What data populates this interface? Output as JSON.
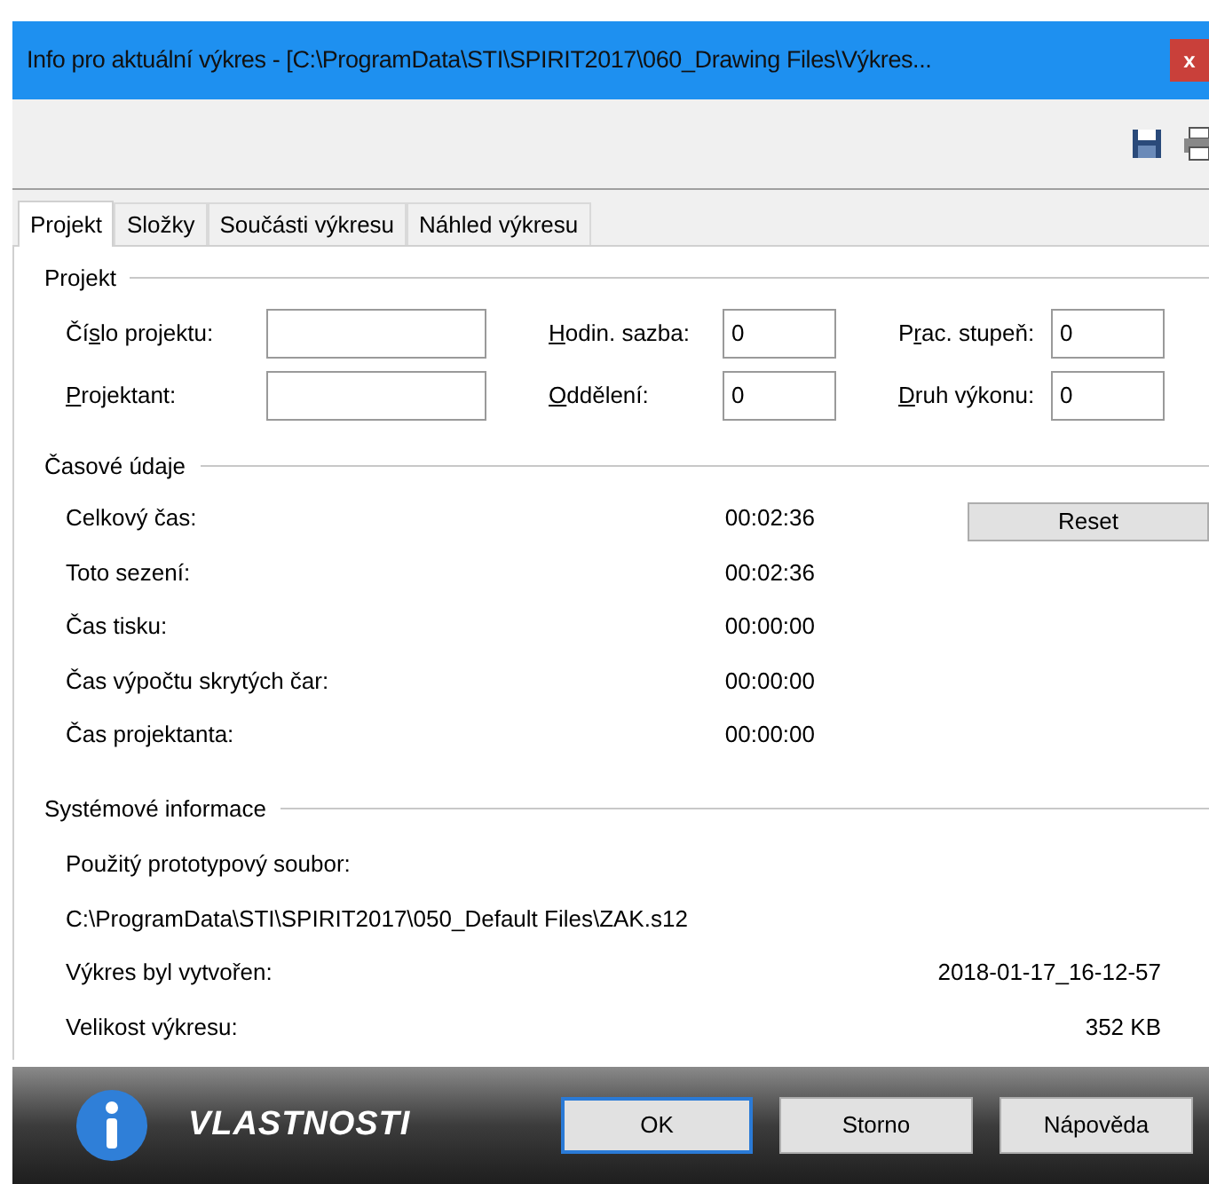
{
  "window": {
    "title": "Info pro aktuální výkres - [C:\\ProgramData\\STI\\SPIRIT2017\\060_Drawing Files\\Výkres...",
    "close": "x"
  },
  "tabs": [
    {
      "label": "Projekt",
      "selected": true
    },
    {
      "label": "Složky",
      "selected": false
    },
    {
      "label": "Součásti výkresu",
      "selected": false
    },
    {
      "label": "Náhled výkresu",
      "selected": false
    }
  ],
  "project": {
    "title": "Projekt",
    "fields": [
      {
        "kind": "wide",
        "pre": "Čí",
        "key": "s",
        "post": "lo projektu:"
      },
      {
        "kind": "narrow",
        "key": "H",
        "post": "odin. sazba:",
        "value": "0"
      },
      {
        "kind": "narrow",
        "pre": "P",
        "key": "r",
        "post": "ac. stupeň:",
        "value": "0"
      },
      {
        "kind": "wide",
        "key": "P",
        "post": "rojektant:"
      },
      {
        "kind": "narrow",
        "key": "O",
        "post": "ddělení:",
        "value": "0"
      },
      {
        "kind": "narrow",
        "key": "D",
        "post": "ruh výkonu:",
        "value": "0"
      }
    ]
  },
  "time": {
    "title": "Časové údaje",
    "reset": "Reset",
    "rows": [
      {
        "label": "Celkový čas:",
        "value": "00:02:36"
      },
      {
        "label": "Toto sezení:",
        "value": "00:02:36"
      },
      {
        "label": "Čas tisku:",
        "value": "00:00:00"
      },
      {
        "label": "Čas výpočtu skrytých čar:",
        "value": "00:00:00"
      },
      {
        "label": "Čas projektanta:",
        "value": "00:00:00"
      }
    ]
  },
  "system": {
    "title": "Systémové informace",
    "prototype_label": "Použitý prototypový soubor:",
    "prototype_path": "C:\\ProgramData\\STI\\SPIRIT2017\\050_Default Files\\ZAK.s12",
    "rows": [
      {
        "label": "Výkres byl vytvořen:",
        "value": "2018-01-17_16-12-57"
      },
      {
        "label": "Velikost výkresu:",
        "value": "352 KB"
      }
    ]
  },
  "footer": {
    "title": "VLASTNOSTI",
    "buttons": [
      {
        "label": "OK",
        "selected": true
      },
      {
        "label": "Storno",
        "selected": false
      },
      {
        "label": "Nápověda",
        "selected": false
      }
    ]
  }
}
